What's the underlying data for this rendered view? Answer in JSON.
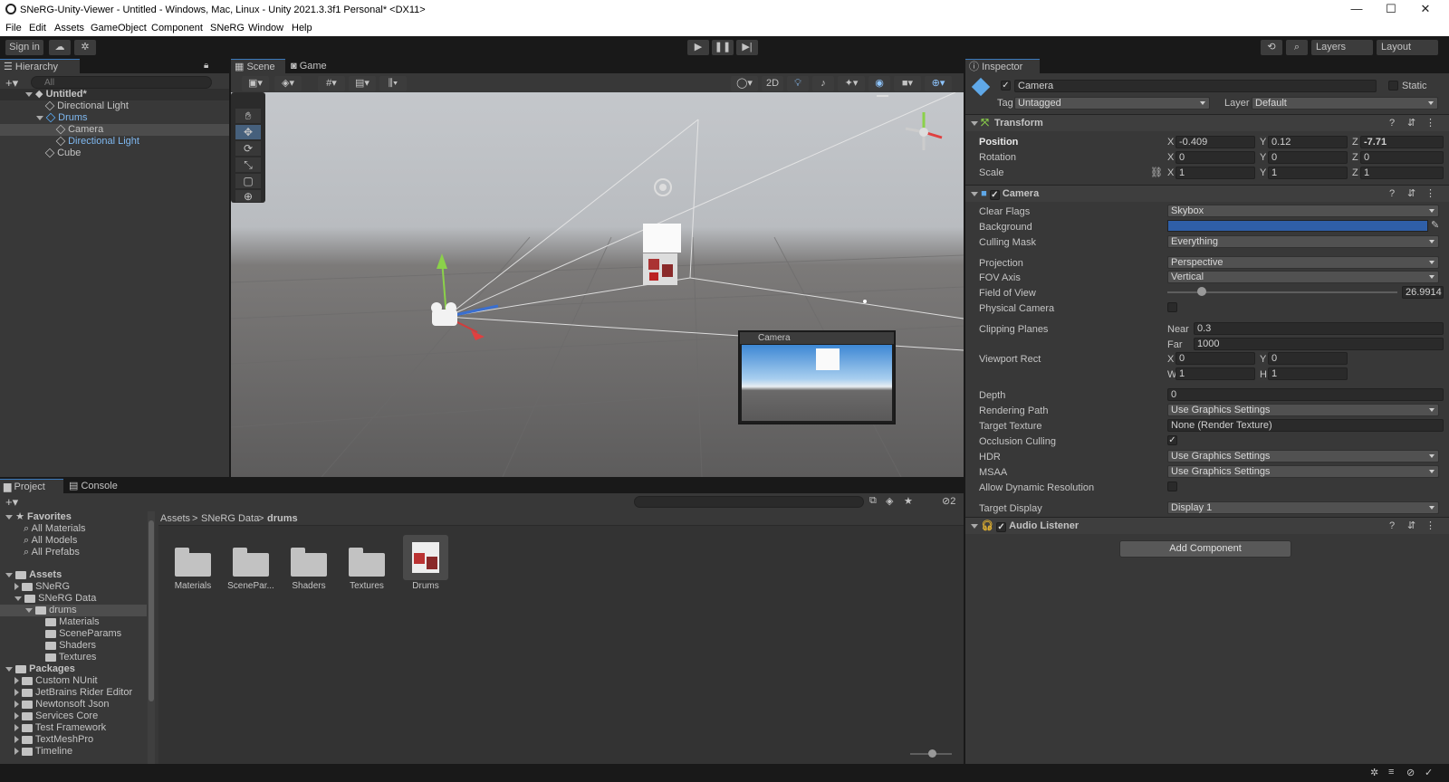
{
  "window": {
    "title": "SNeRG-Unity-Viewer - Untitled - Windows, Mac, Linux - Unity 2021.3.3f1 Personal* <DX11>",
    "minimize": "—",
    "maximize": "☐",
    "close": "✕"
  },
  "menu": [
    "File",
    "Edit",
    "Assets",
    "GameObject",
    "Component",
    "SNeRG",
    "Window",
    "Help"
  ],
  "toolbar": {
    "sign_in": "Sign in",
    "layers": "Layers",
    "layout": "Layout"
  },
  "hierarchy": {
    "tab": "Hierarchy",
    "search_placeholder": "All",
    "items": [
      "Untitled*",
      "Directional Light",
      "Drums",
      "Camera",
      "Directional Light",
      "Cube"
    ]
  },
  "scene": {
    "tabs": [
      "Scene",
      "Game"
    ],
    "mode_2d": "2D",
    "camera_preview_title": "Camera"
  },
  "inspector": {
    "tab": "Inspector",
    "object_name": "Camera",
    "static_label": "Static",
    "tag_label": "Tag",
    "tag_value": "Untagged",
    "layer_label": "Layer",
    "layer_value": "Default",
    "transform": {
      "title": "Transform",
      "position_label": "Position",
      "rotation_label": "Rotation",
      "scale_label": "Scale",
      "axis_x": "X",
      "axis_y": "Y",
      "axis_z": "Z",
      "position": [
        "-0.409",
        "0.12",
        "-7.71"
      ],
      "rotation": [
        "0",
        "0",
        "0"
      ],
      "scale": [
        "1",
        "1",
        "1"
      ]
    },
    "camera": {
      "title": "Camera",
      "clear_flags_label": "Clear Flags",
      "clear_flags": "Skybox",
      "background_label": "Background",
      "background_color": "#2f5fa8",
      "culling_mask_label": "Culling Mask",
      "culling_mask": "Everything",
      "projection_label": "Projection",
      "projection": "Perspective",
      "fov_axis_label": "FOV Axis",
      "fov_axis": "Vertical",
      "fov_label": "Field of View",
      "fov": "26.9914",
      "fov_slider_fraction": 0.15,
      "physical_camera_label": "Physical Camera",
      "clipping_label": "Clipping Planes",
      "near_label": "Near",
      "near": "0.3",
      "far_label": "Far",
      "far": "1000",
      "viewport_label": "Viewport Rect",
      "vx": "0",
      "vy": "0",
      "vw": "1",
      "vh": "1",
      "w_label": "W",
      "h_label": "H",
      "depth_label": "Depth",
      "depth": "0",
      "rendering_path_label": "Rendering Path",
      "rendering_path": "Use Graphics Settings",
      "target_texture_label": "Target Texture",
      "target_texture": "None (Render Texture)",
      "occlusion_label": "Occlusion Culling",
      "hdr_label": "HDR",
      "hdr": "Use Graphics Settings",
      "msaa_label": "MSAA",
      "msaa": "Use Graphics Settings",
      "dynres_label": "Allow Dynamic Resolution",
      "target_display_label": "Target Display",
      "target_display": "Display 1"
    },
    "audio_listener": "Audio Listener",
    "add_component": "Add Component"
  },
  "project": {
    "tabs": [
      "Project",
      "Console"
    ],
    "breadcrumb": [
      "Assets",
      "SNeRG Data",
      "drums"
    ],
    "hidden_count": "2",
    "tree": {
      "favorites": "Favorites",
      "fav_items": [
        "All Materials",
        "All Models",
        "All Prefabs"
      ],
      "assets": "Assets",
      "asset_items": [
        "SNeRG",
        "SNeRG Data",
        "drums",
        "Materials",
        "SceneParams",
        "Shaders",
        "Textures"
      ],
      "packages": "Packages",
      "package_items": [
        "Custom NUnit",
        "JetBrains Rider Editor",
        "Newtonsoft Json",
        "Services Core",
        "Test Framework",
        "TextMeshPro",
        "Timeline"
      ]
    },
    "grid": [
      "Materials",
      "ScenePar...",
      "Shaders",
      "Textures",
      "Drums"
    ]
  }
}
